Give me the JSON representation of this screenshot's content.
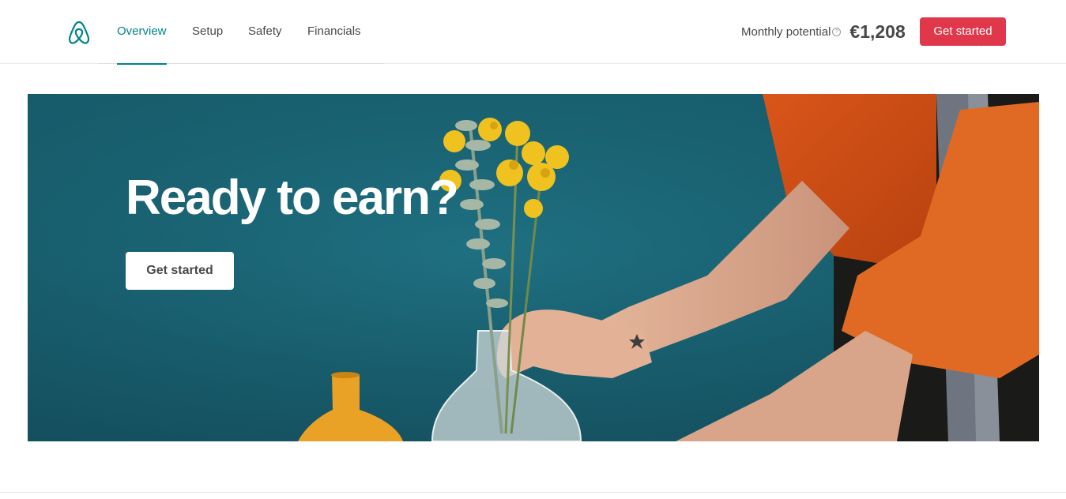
{
  "header": {
    "logo_icon": "airbnb-logo-icon",
    "brand_color": "#008489",
    "nav_tabs": [
      {
        "label": "Overview",
        "active": true
      },
      {
        "label": "Setup",
        "active": false
      },
      {
        "label": "Safety",
        "active": false
      },
      {
        "label": "Financials",
        "active": false
      }
    ],
    "monthly_potential_label": "Monthly potential",
    "help_icon": "question-circle-icon",
    "monthly_potential_value": "€1,208",
    "cta_label": "Get started",
    "cta_color": "#e0374a"
  },
  "hero": {
    "title": "Ready to earn?",
    "cta_label": "Get started",
    "background_color": "#1a6575"
  }
}
